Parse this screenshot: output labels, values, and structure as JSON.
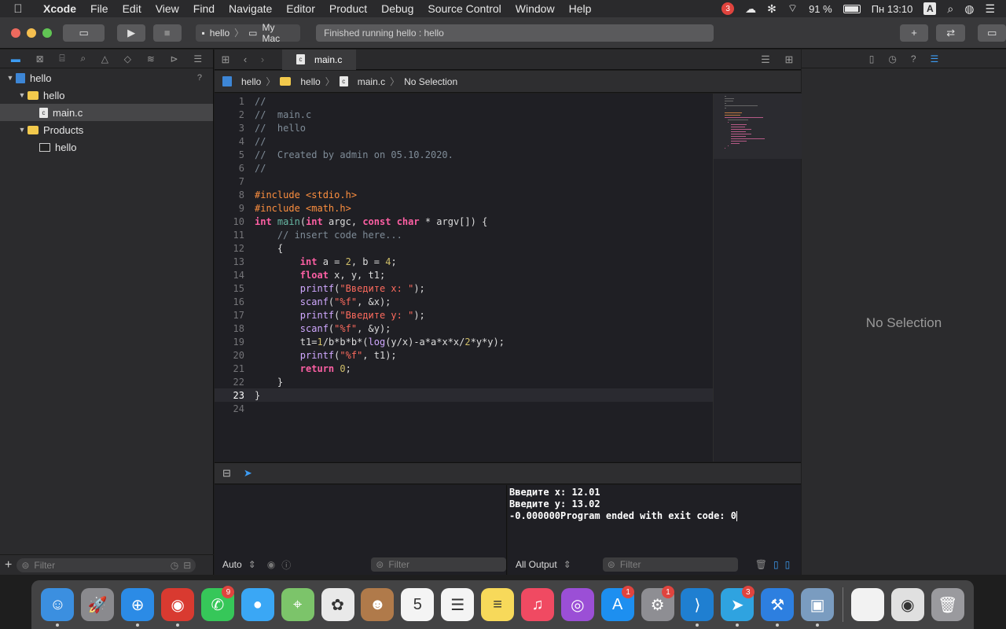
{
  "menubar": {
    "app_name": "Xcode",
    "items": [
      "File",
      "Edit",
      "View",
      "Find",
      "Navigate",
      "Editor",
      "Product",
      "Debug",
      "Source Control",
      "Window",
      "Help"
    ],
    "notif_badge": "3",
    "battery": "91 %",
    "clock": "Пн 13:10",
    "input_source": "A"
  },
  "toolbar": {
    "scheme_target": "hello",
    "scheme_device": "My Mac",
    "activity_text": "Finished running hello : hello",
    "add_label": "+"
  },
  "navigator": {
    "rows": [
      {
        "label": "hello",
        "kind": "project",
        "level": 0
      },
      {
        "label": "hello",
        "kind": "folder",
        "level": 1
      },
      {
        "label": "main.c",
        "kind": "file",
        "level": 2
      },
      {
        "label": "Products",
        "kind": "folder",
        "level": 1
      },
      {
        "label": "hello",
        "kind": "exec",
        "level": 2
      }
    ],
    "project_status": "?",
    "filter_placeholder": "Filter"
  },
  "editor": {
    "tab_label": "main.c",
    "jumpbar": [
      "hello",
      "hello",
      "main.c",
      "No Selection"
    ],
    "current_line": "23"
  },
  "code_lines": [
    "//",
    "//  main.c",
    "//  hello",
    "//",
    "//  Created by admin on 05.10.2020.",
    "//",
    "",
    "#include <stdio.h>",
    "#include <math.h>",
    "int main(int argc, const char * argv[]) {",
    "    // insert code here...",
    "    {",
    "        int a = 2, b = 4;",
    "        float x, y, t1;",
    "        printf(\"Введите x: \");",
    "        scanf(\"%f\", &x);",
    "        printf(\"Введите y: \");",
    "        scanf(\"%f\", &y);",
    "        t1=1/b*b*b*(log(y/x)-a*a*x*x/2*y*y);",
    "        printf(\"%f\", t1);",
    "        return 0;",
    "    }",
    "}",
    ""
  ],
  "debug": {
    "variables_mode": "Auto",
    "variables_filter_placeholder": "Filter",
    "console_mode": "All Output",
    "console_filter_placeholder": "Filter",
    "console_lines": [
      "Введите x: 12.01",
      "Введите y: 13.02",
      "-0.000000Program ended with exit code: 0"
    ]
  },
  "inspector": {
    "empty_text": "No Selection"
  },
  "dock": {
    "apps": [
      {
        "name": "Finder",
        "icon": "finder-icon",
        "color": "#3b8fe0",
        "glyph": "☺",
        "running": true
      },
      {
        "name": "Launchpad",
        "icon": "launchpad-icon",
        "color": "#8a8a8e",
        "glyph": "🚀",
        "running": false
      },
      {
        "name": "Safari",
        "icon": "safari-icon",
        "color": "#2b8be6",
        "glyph": "⊕",
        "running": true
      },
      {
        "name": "Chrome",
        "icon": "chrome-icon",
        "color": "#d93a30",
        "glyph": "◉",
        "running": true
      },
      {
        "name": "FaceTime",
        "icon": "facetime-icon",
        "color": "#36c759",
        "glyph": "✆",
        "badge": "9",
        "running": false
      },
      {
        "name": "Messages",
        "icon": "messages-icon",
        "color": "#3aa7f5",
        "glyph": "●",
        "running": false
      },
      {
        "name": "Maps",
        "icon": "maps-icon",
        "color": "#7cc46a",
        "glyph": "⌖",
        "running": false
      },
      {
        "name": "Photos",
        "icon": "photos-icon",
        "color": "#e9e9e9",
        "glyph": "✿",
        "running": false
      },
      {
        "name": "Contacts",
        "icon": "contacts-icon",
        "color": "#b07a4a",
        "glyph": "☻",
        "running": false
      },
      {
        "name": "Calendar",
        "icon": "calendar-icon",
        "color": "#f4f4f4",
        "glyph": "5",
        "running": false
      },
      {
        "name": "Reminders",
        "icon": "reminders-icon",
        "color": "#f4f4f4",
        "glyph": "☰",
        "running": false
      },
      {
        "name": "Notes",
        "icon": "notes-icon",
        "color": "#f7d95a",
        "glyph": "≡",
        "running": false
      },
      {
        "name": "Music",
        "icon": "music-icon",
        "color": "#f04a62",
        "glyph": "♫",
        "running": false
      },
      {
        "name": "Podcasts",
        "icon": "podcasts-icon",
        "color": "#9b4fd6",
        "glyph": "◎",
        "running": false
      },
      {
        "name": "App Store",
        "icon": "app-store-icon",
        "color": "#1d8ff0",
        "glyph": "A",
        "badge": "1",
        "running": false
      },
      {
        "name": "System Preferences",
        "icon": "settings-icon",
        "color": "#8e8e93",
        "glyph": "⚙",
        "badge": "1",
        "running": false
      },
      {
        "name": "VS Code",
        "icon": "vscode-icon",
        "color": "#1f7fd1",
        "glyph": "⟩",
        "running": true
      },
      {
        "name": "Telegram",
        "icon": "telegram-icon",
        "color": "#2fa3e0",
        "glyph": "➤",
        "badge": "3",
        "running": true
      },
      {
        "name": "Xcode",
        "icon": "xcode-icon",
        "color": "#2d7fe0",
        "glyph": "⚒",
        "running": true
      },
      {
        "name": "Preview",
        "icon": "preview-icon",
        "color": "#7a9cc0",
        "glyph": "▣",
        "running": true
      }
    ],
    "stack": [
      {
        "name": "Document",
        "icon": "document-icon",
        "color": "#f2f2f2",
        "glyph": ""
      },
      {
        "name": "Downloads",
        "icon": "downloads-stack-icon",
        "color": "#e0e0e0",
        "glyph": "◉"
      },
      {
        "name": "Trash",
        "icon": "trash-icon",
        "color": "#9a9a9e",
        "glyph": "🗑"
      }
    ]
  }
}
